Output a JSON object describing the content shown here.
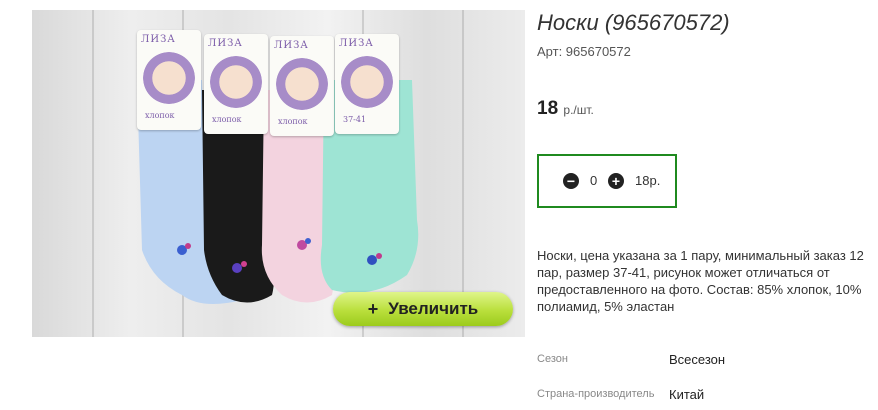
{
  "product": {
    "title": "Носки (965670572)",
    "sku": "Арт: 965670572",
    "price_value": "18",
    "price_unit": "р./шт."
  },
  "quantity": {
    "minus_icon": "minus-circle-icon",
    "plus_icon": "plus-circle-icon",
    "value": "0",
    "sum": "18р."
  },
  "zoom": {
    "label": "Увеличить",
    "icon": "+"
  },
  "photo": {
    "brand": "ЛИЗА",
    "material": "хлопок",
    "size": "37-41",
    "sock_colors": [
      "#bcd4f2",
      "#1a1a1a",
      "#f3d3df",
      "#9ee4d4"
    ],
    "accent": "#1f8a1f"
  },
  "description": "Носки, цена указана за 1 пару, минимальный заказ 12 пар, размер 37-41, рисунок может отличаться от предоставленного на фото. Состав: 85% хлопок, 10% полиамид, 5% эластан",
  "properties": [
    {
      "key": "Сезон",
      "value": "Всесезон"
    },
    {
      "key": "Страна-производитель",
      "value": "Китай"
    }
  ]
}
